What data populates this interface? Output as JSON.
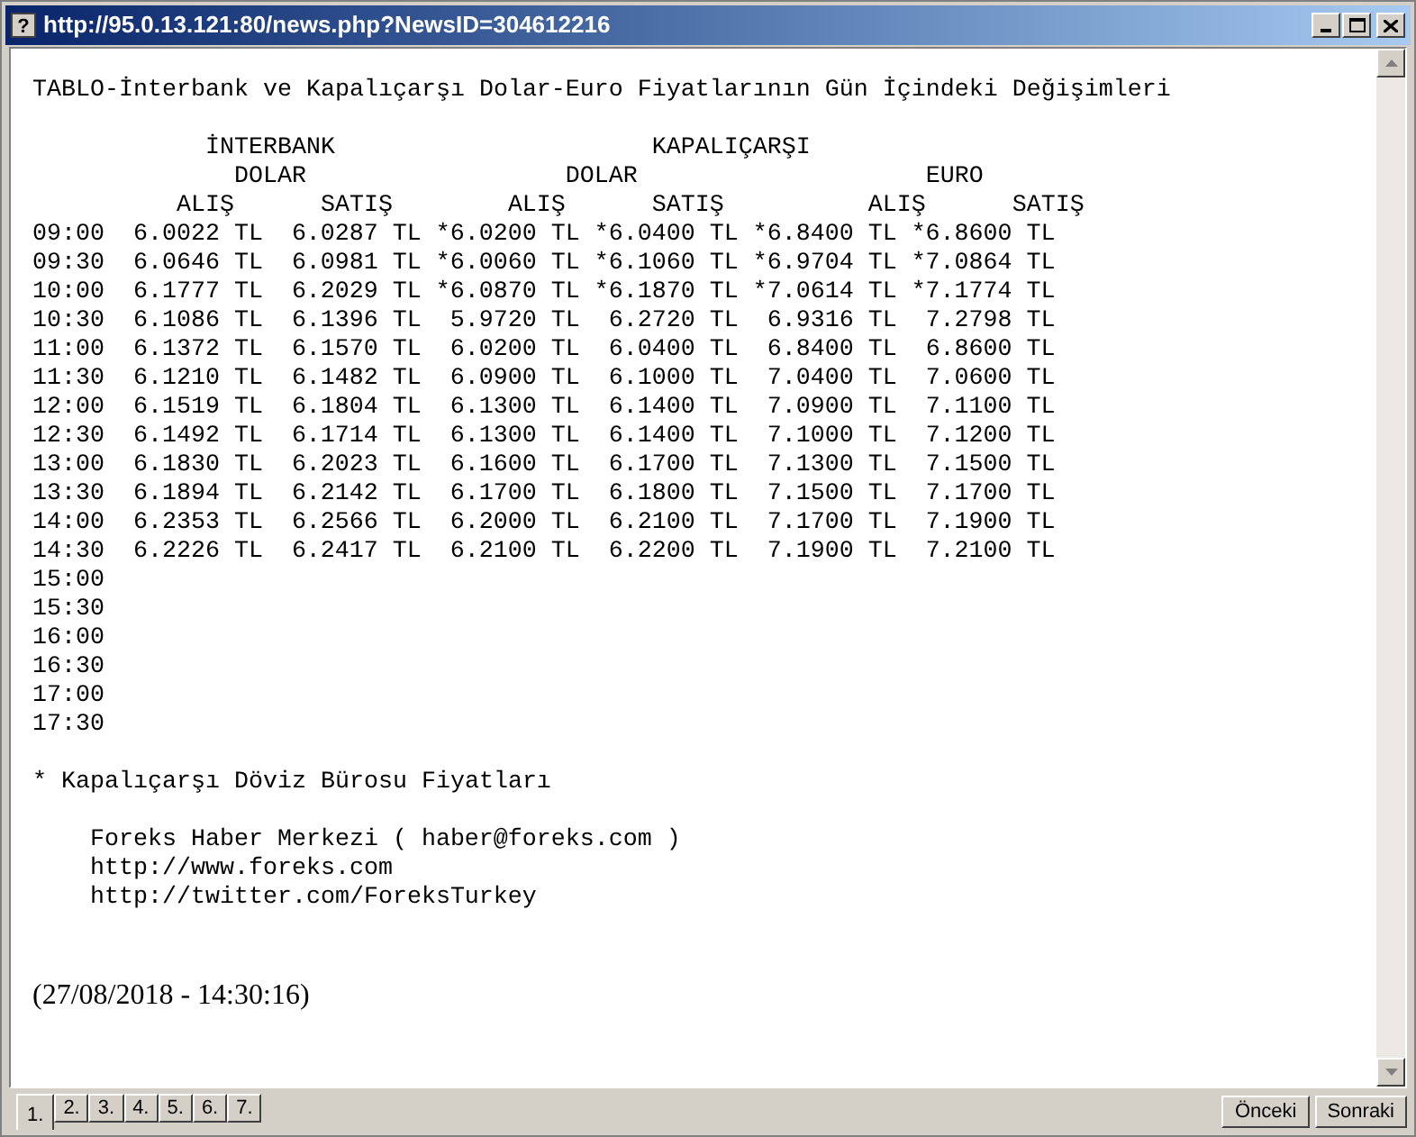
{
  "window": {
    "icon": "?",
    "title": "http://95.0.13.121:80/news.php?NewsID=304612216"
  },
  "heading": "TABLO-İnterbank ve Kapalıçarşı Dolar-Euro Fiyatlarının Gün İçindeki Değişimleri",
  "table": {
    "header_rows": [
      [
        "İNTERBANK",
        "KAPALIÇARŞI"
      ],
      [
        "DOLAR",
        "DOLAR",
        "EURO"
      ],
      [
        "ALIŞ",
        "SATIŞ",
        "ALIŞ",
        "SATIŞ",
        "ALIŞ",
        "SATIŞ"
      ]
    ],
    "rows": [
      {
        "time": "09:00",
        "values": [
          "6.0022 TL",
          "6.0287 TL",
          "*6.0200 TL",
          "*6.0400 TL",
          "*6.8400 TL",
          "*6.8600 TL"
        ]
      },
      {
        "time": "09:30",
        "values": [
          "6.0646 TL",
          "6.0981 TL",
          "*6.0060 TL",
          "*6.1060 TL",
          "*6.9704 TL",
          "*7.0864 TL"
        ]
      },
      {
        "time": "10:00",
        "values": [
          "6.1777 TL",
          "6.2029 TL",
          "*6.0870 TL",
          "*6.1870 TL",
          "*7.0614 TL",
          "*7.1774 TL"
        ]
      },
      {
        "time": "10:30",
        "values": [
          "6.1086 TL",
          "6.1396 TL",
          "5.9720 TL",
          "6.2720 TL",
          "6.9316 TL",
          "7.2798 TL"
        ]
      },
      {
        "time": "11:00",
        "values": [
          "6.1372 TL",
          "6.1570 TL",
          "6.0200 TL",
          "6.0400 TL",
          "6.8400 TL",
          "6.8600 TL"
        ]
      },
      {
        "time": "11:30",
        "values": [
          "6.1210 TL",
          "6.1482 TL",
          "6.0900 TL",
          "6.1000 TL",
          "7.0400 TL",
          "7.0600 TL"
        ]
      },
      {
        "time": "12:00",
        "values": [
          "6.1519 TL",
          "6.1804 TL",
          "6.1300 TL",
          "6.1400 TL",
          "7.0900 TL",
          "7.1100 TL"
        ]
      },
      {
        "time": "12:30",
        "values": [
          "6.1492 TL",
          "6.1714 TL",
          "6.1300 TL",
          "6.1400 TL",
          "7.1000 TL",
          "7.1200 TL"
        ]
      },
      {
        "time": "13:00",
        "values": [
          "6.1830 TL",
          "6.2023 TL",
          "6.1600 TL",
          "6.1700 TL",
          "7.1300 TL",
          "7.1500 TL"
        ]
      },
      {
        "time": "13:30",
        "values": [
          "6.1894 TL",
          "6.2142 TL",
          "6.1700 TL",
          "6.1800 TL",
          "7.1500 TL",
          "7.1700 TL"
        ]
      },
      {
        "time": "14:00",
        "values": [
          "6.2353 TL",
          "6.2566 TL",
          "6.2000 TL",
          "6.2100 TL",
          "7.1700 TL",
          "7.1900 TL"
        ]
      },
      {
        "time": "14:30",
        "values": [
          "6.2226 TL",
          "6.2417 TL",
          "6.2100 TL",
          "6.2200 TL",
          "7.1900 TL",
          "7.2100 TL"
        ]
      },
      {
        "time": "15:00"
      },
      {
        "time": "15:30"
      },
      {
        "time": "16:00"
      },
      {
        "time": "16:30"
      },
      {
        "time": "17:00"
      },
      {
        "time": "17:30"
      }
    ]
  },
  "footnote": "* Kapalıçarşı Döviz Bürosu Fiyatları",
  "contact_lines": [
    "Foreks Haber Merkezi ( haber@foreks.com )",
    "http://www.foreks.com",
    "http://twitter.com/ForeksTurkey"
  ],
  "timestamp": "(27/08/2018 - 14:30:16)",
  "page_tabs": [
    {
      "label": "1.",
      "selected": true
    },
    {
      "label": "2.",
      "selected": false
    },
    {
      "label": "3.",
      "selected": false
    },
    {
      "label": "4.",
      "selected": false
    },
    {
      "label": "5.",
      "selected": false
    },
    {
      "label": "6.",
      "selected": false
    },
    {
      "label": "7.",
      "selected": false
    }
  ],
  "nav_buttons": [
    "Önceki",
    "Sonraki"
  ]
}
